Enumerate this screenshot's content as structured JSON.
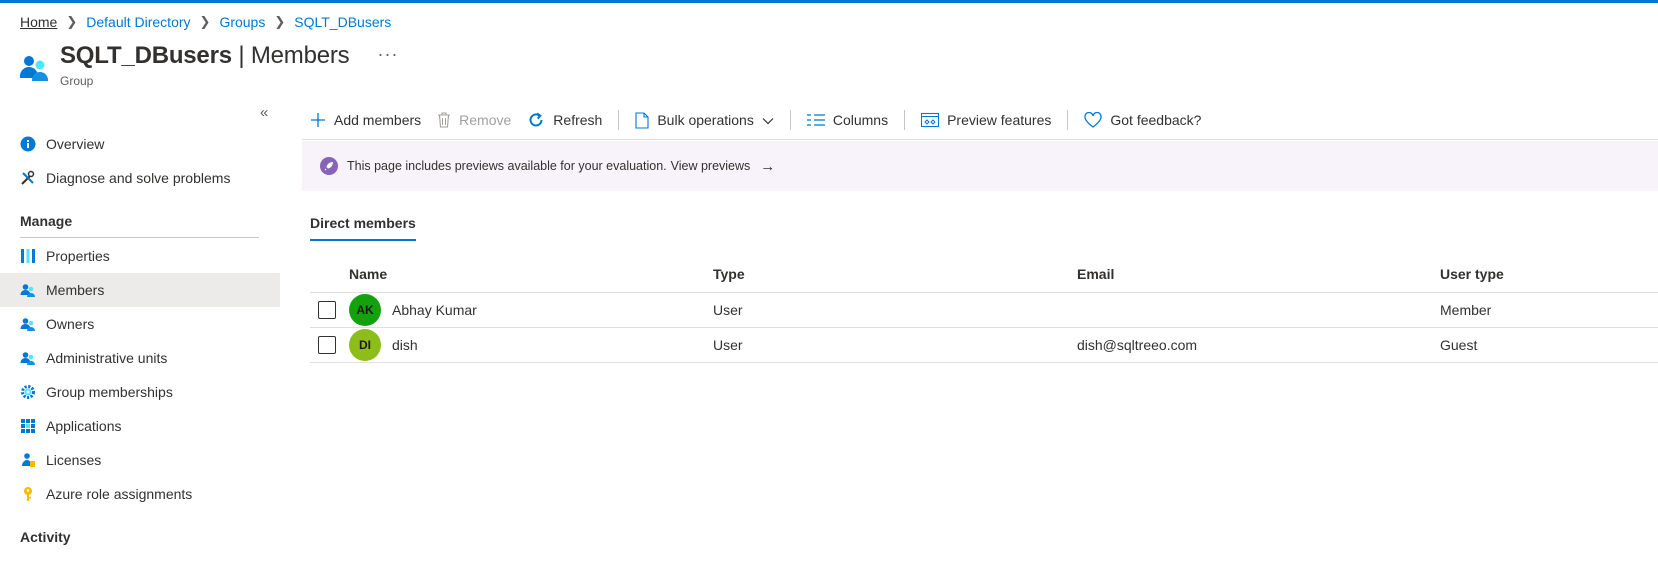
{
  "breadcrumb": [
    "Home",
    "Default Directory",
    "Groups",
    "SQLT_DBusers"
  ],
  "header": {
    "name": "SQLT_DBusers",
    "separator": "|",
    "page": "Members",
    "subtitle": "Group",
    "more": "···"
  },
  "sidebar": {
    "collapse_glyph": "«",
    "items": [
      {
        "label": "Overview",
        "icon": "info-icon"
      },
      {
        "label": "Diagnose and solve problems",
        "icon": "wrench-icon"
      }
    ],
    "manage_heading": "Manage",
    "manage_items": [
      {
        "label": "Properties",
        "icon": "properties-icon"
      },
      {
        "label": "Members",
        "icon": "members-icon",
        "active": true
      },
      {
        "label": "Owners",
        "icon": "owners-icon"
      },
      {
        "label": "Administrative units",
        "icon": "admin-units-icon"
      },
      {
        "label": "Group memberships",
        "icon": "gear-icon"
      },
      {
        "label": "Applications",
        "icon": "grid-icon"
      },
      {
        "label": "Licenses",
        "icon": "license-icon"
      },
      {
        "label": "Azure role assignments",
        "icon": "key-icon"
      }
    ],
    "activity_heading": "Activity"
  },
  "toolbar": {
    "add": "Add members",
    "remove": "Remove",
    "refresh": "Refresh",
    "bulk": "Bulk operations",
    "columns": "Columns",
    "preview": "Preview features",
    "feedback": "Got feedback?"
  },
  "banner": {
    "text": "This page includes previews available for your evaluation.",
    "link": "View previews",
    "arrow": "→"
  },
  "tab": "Direct members",
  "table": {
    "columns": [
      "Name",
      "Type",
      "Email",
      "User type"
    ],
    "rows": [
      {
        "initials": "AK",
        "name": "Abhay Kumar",
        "type": "User",
        "email": "",
        "user_type": "Member",
        "avatar_color": "#13a10e"
      },
      {
        "initials": "DI",
        "name": "dish",
        "type": "User",
        "email": "dish@sqltreeo.com",
        "user_type": "Guest",
        "avatar_color": "#8cbd18"
      }
    ]
  },
  "colors": {
    "accent": "#0078d4",
    "active_bg": "#edebe9",
    "banner_bg": "#f8f3fa"
  }
}
